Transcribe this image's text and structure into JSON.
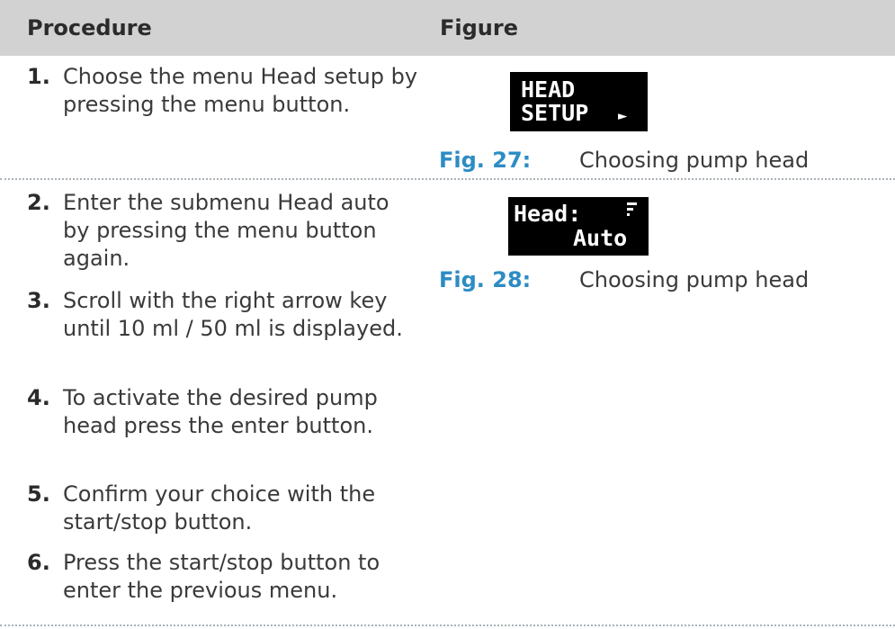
{
  "header": {
    "procedure_label": "Procedure",
    "figure_label": "Figure"
  },
  "steps": [
    {
      "number": "1.",
      "text": "Choose the menu Head setup by pressing the menu button."
    },
    {
      "number": "2.",
      "text": "Enter the submenu Head auto by pressing the menu button again."
    },
    {
      "number": "3.",
      "text": "Scroll with the right arrow key until 10 ml / 50 ml is displayed."
    },
    {
      "number": "4.",
      "text": "To activate the desired pump head press the enter button."
    },
    {
      "number": "5.",
      "text": "Confirm your choice with the start/stop button."
    },
    {
      "number": "6.",
      "text": "Press the start/stop button to enter the previous menu."
    }
  ],
  "figures": [
    {
      "display_line1": "HEAD",
      "display_line2": "SETUP",
      "display_arrow": "►",
      "fig_label": "Fig. 27:",
      "caption": "Choosing pump head"
    },
    {
      "display_line1": "Head:",
      "display_line2": "Auto",
      "display_icon": "signal-strength-icon",
      "fig_label": "Fig. 28:",
      "caption": "Choosing pump head"
    }
  ],
  "colors": {
    "header_bg": "#d2d2d2",
    "figure_label": "#2d8cc4",
    "separator": "#aab2b8",
    "display_bg": "#000000"
  }
}
